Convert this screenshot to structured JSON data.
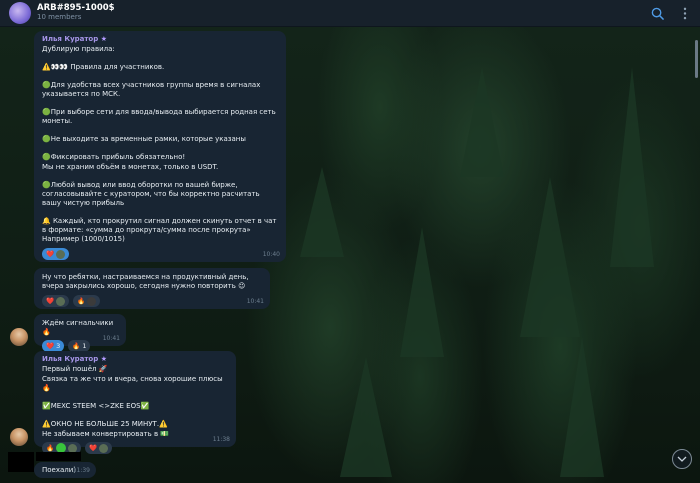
{
  "header": {
    "title": "ARB#895-1000$",
    "subtitle": "10 members",
    "icons": [
      "search-icon",
      "more-icon"
    ]
  },
  "messages": {
    "rules": {
      "sender": "Илья Куратор",
      "lines": [
        "Дублирую правила:",
        "⚠️👀👀 Правила для участников.",
        "🟢Для удобства всех участников группы время в сигналах указывается по МСК.",
        "🟢При выборе сети для ввода/вывода выбирается родная сеть монеты.",
        "🟢Не выходите за временные рамки, которые указаны",
        "🟢Фиксировать прибыль обязательно!",
        "Мы не храним объём в монетах, только в USDT.",
        "🟢Любой вывод или ввод оборотки по вашей бирже, согласовывайте с куратором, что бы корректно расчитать вашу чистую  прибыль",
        "🔔 Каждый, кто прокрутил сигнал должен скинуть отчет в чат в формате: «сумма до прокрута/сумма после прокрута» Например (1000/1015)"
      ],
      "time": "10:40",
      "reactions": [
        "❤️"
      ]
    },
    "morning": {
      "text": "Ну что ребятки, настраиваемся на продуктивный день, вчера закрылись хорошо, сегодня нужно повторить 😉",
      "time": "10:41",
      "reactions": [
        "❤️",
        "🔥"
      ]
    },
    "waiting": {
      "text": "Ждём сигнальчики 🔥",
      "time": "10:41",
      "reactions": [
        {
          "emoji": "❤️",
          "count": "3"
        },
        {
          "emoji": "🔥",
          "count": "1"
        }
      ]
    },
    "first": {
      "sender": "Илья Куратор",
      "lines": [
        "Первый пошёл 🚀",
        "Связка та же что и вчера, снова хорошие плюсы 🔥",
        "✅MEXC  STEEM <>ZKE  EOS✅",
        "⚠️ОКНО НЕ БОЛЬШЕ 25 МИНУТ.⚠️",
        "Не забываем конвертировать в 💵"
      ],
      "time": "11:38",
      "reactions": [
        "🔥",
        "❤️"
      ]
    },
    "go": {
      "text": "Поехали)",
      "time": "11:39"
    }
  }
}
